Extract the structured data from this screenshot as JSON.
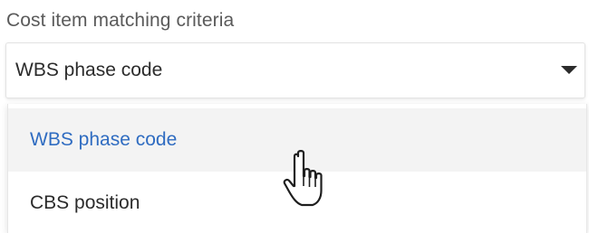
{
  "field": {
    "label": "Cost item matching criteria",
    "selected_value": "WBS phase code"
  },
  "dropdown": {
    "options": [
      {
        "label": "WBS phase code",
        "state": "selected-hover"
      },
      {
        "label": "CBS position",
        "state": "normal"
      }
    ]
  },
  "colors": {
    "selected_option_text": "#2f6cc1",
    "hover_background": "#f3f3f3",
    "label_text": "#5a5a5a",
    "value_text": "#2b2b2b"
  },
  "icons": {
    "caret": "caret-down-icon",
    "pointer": "hand-cursor-icon"
  }
}
